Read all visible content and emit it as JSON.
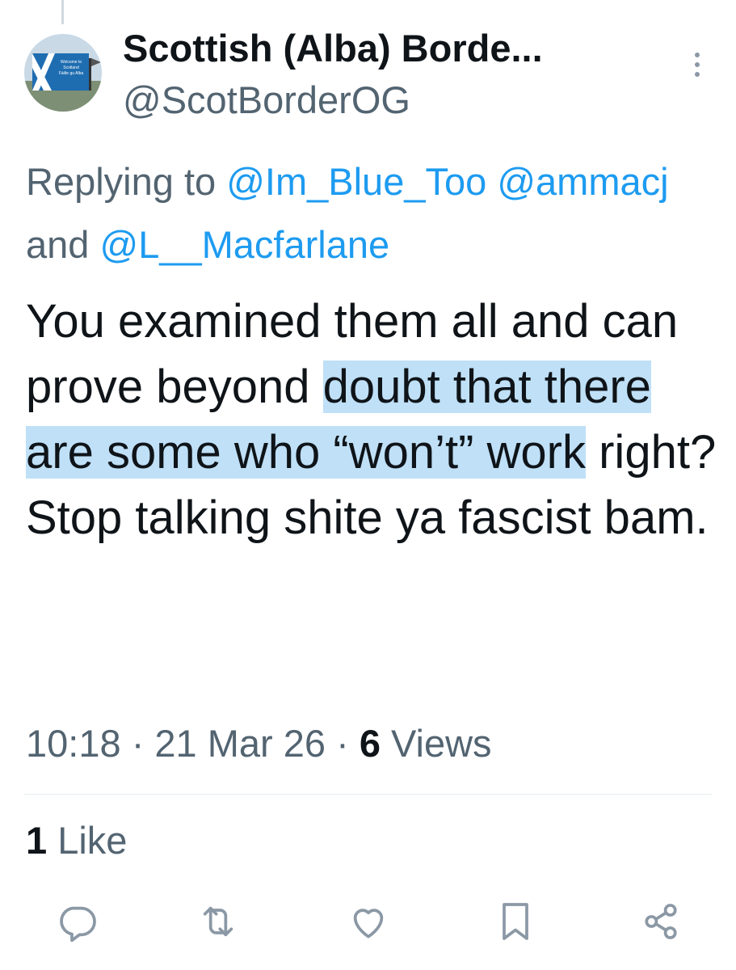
{
  "author": {
    "display_name": "Scottish (Alba) Borde...",
    "handle": "@ScotBorderOG",
    "avatar_sign_lines": [
      "Welcome to",
      "Scotland",
      "Fàilte gu Alba"
    ]
  },
  "reply": {
    "prefix": "Replying to",
    "mention_1": "@Im_Blue_Too",
    "mention_2": "@ammacj",
    "conjunction": "and",
    "mention_3": "@L__Macfarlane"
  },
  "tweet": {
    "text_part_1": "You examined them all and can prove beyond ",
    "text_highlighted": "doubt that there are some who “won’t” work",
    "text_part_2": " right?",
    "text_line_2": "Stop talking shite ya fascist bam."
  },
  "meta": {
    "time": "10:18",
    "separator": "·",
    "date": "21 Mar 26",
    "views_count": "6",
    "views_label": "Views"
  },
  "likes": {
    "count": "1",
    "label": "Like"
  },
  "actions": [
    "reply-icon",
    "retweet-icon",
    "like-icon",
    "bookmark-icon",
    "share-icon"
  ],
  "colors": {
    "link": "#1d9bf0",
    "secondary_text": "#536471",
    "primary_text": "#0f1419",
    "highlight": "#bfe0f7",
    "divider": "#e6ecf0"
  }
}
